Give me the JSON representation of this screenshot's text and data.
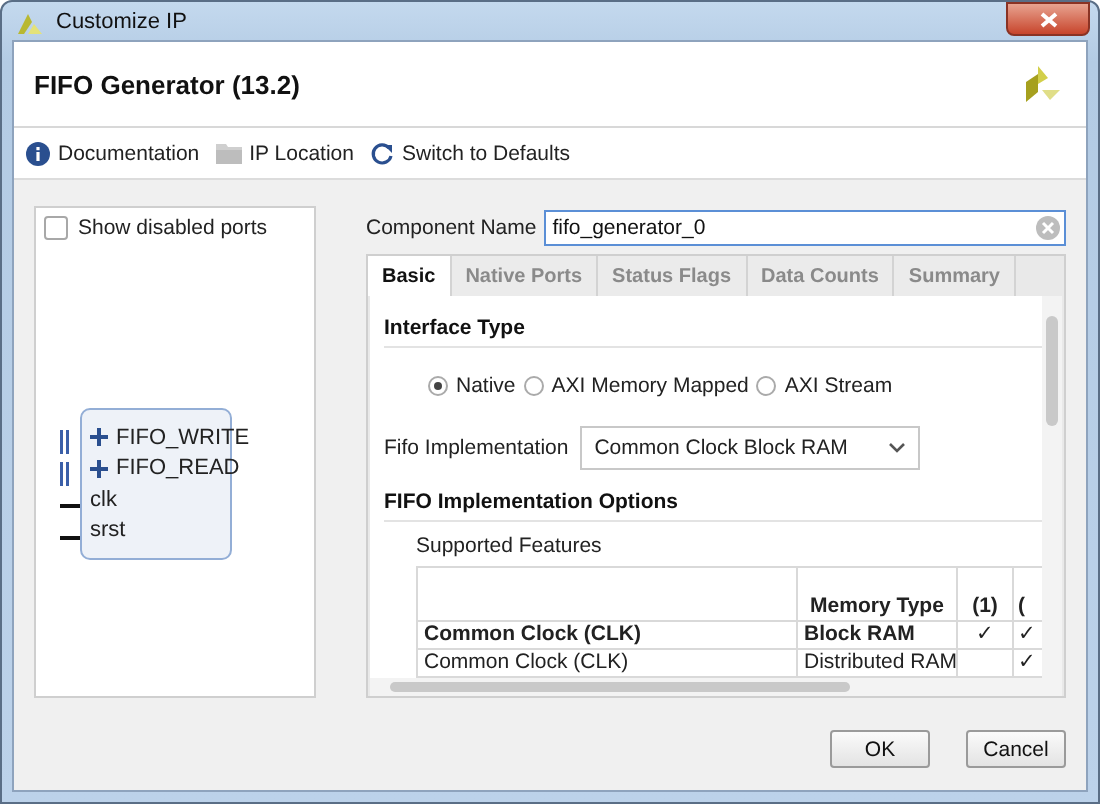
{
  "window": {
    "title": "Customize IP"
  },
  "header": {
    "title": "FIFO Generator (13.2)"
  },
  "toolbar": [
    {
      "kind": "info",
      "label": "Documentation"
    },
    {
      "kind": "folder",
      "label": "IP Location"
    },
    {
      "kind": "reset",
      "label": "Switch to Defaults"
    }
  ],
  "symbol_panel": {
    "show_disabled_ports": {
      "label": "Show disabled ports",
      "checked": false
    },
    "ports": [
      {
        "kind": "bus",
        "name": "FIFO_WRITE"
      },
      {
        "kind": "bus",
        "name": "FIFO_READ"
      },
      {
        "kind": "wire",
        "name": "clk"
      },
      {
        "kind": "wire",
        "name": "srst"
      }
    ]
  },
  "component_name": {
    "label": "Component Name",
    "value": "fifo_generator_0"
  },
  "tabs": [
    {
      "label": "Basic",
      "selected": true
    },
    {
      "label": "Native Ports",
      "selected": false
    },
    {
      "label": "Status Flags",
      "selected": false
    },
    {
      "label": "Data Counts",
      "selected": false
    },
    {
      "label": "Summary",
      "selected": false
    }
  ],
  "interface_type": {
    "heading": "Interface Type",
    "options": [
      {
        "label": "Native",
        "selected": true
      },
      {
        "label": "AXI Memory Mapped",
        "selected": false
      },
      {
        "label": "AXI Stream",
        "selected": false
      }
    ]
  },
  "fifo_implementation": {
    "label": "Fifo Implementation",
    "value": "Common Clock Block RAM"
  },
  "implementation_options": {
    "heading": "FIFO Implementation Options",
    "subheading": "Supported Features",
    "columns": [
      "",
      "Memory Type",
      "(1)",
      "("
    ],
    "rows": [
      {
        "bold": true,
        "cells": [
          "Common Clock (CLK)",
          "Block RAM",
          "✓",
          "✓"
        ]
      },
      {
        "bold": false,
        "cells": [
          "Common Clock (CLK)",
          "Distributed RAM",
          null,
          "✓"
        ]
      }
    ]
  },
  "buttons": [
    "OK",
    "Cancel"
  ]
}
